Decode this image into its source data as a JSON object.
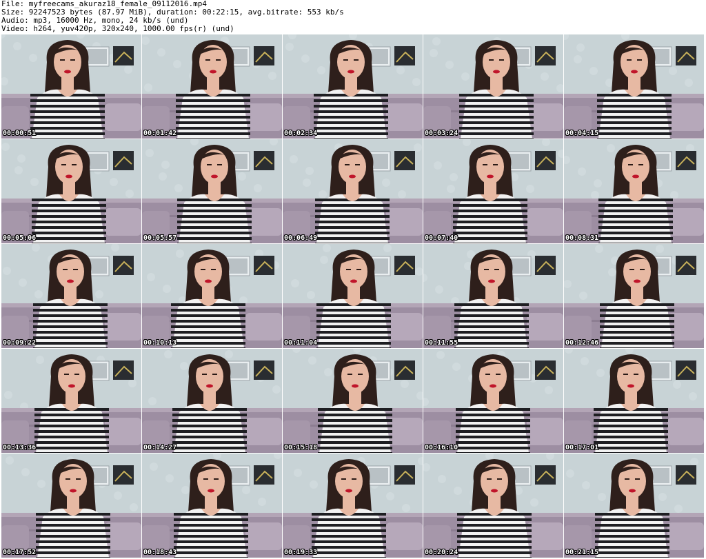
{
  "header": {
    "file_line": "File: myfreecams_akuraz18_female_09112016.mp4",
    "size_line": "Size: 92247523 bytes (87.97 MiB), duration: 00:22:15, avg.bitrate: 553 kb/s",
    "audio_line": "Audio: mp3, 16000 Hz, mono, 24 kb/s (und)",
    "video_line": "Video: h264, yuv420p, 320x240, 1000.00 fps(r) (und)"
  },
  "thumbnails": [
    {
      "time": "00:00:51"
    },
    {
      "time": "00:01:42"
    },
    {
      "time": "00:02:34"
    },
    {
      "time": "00:03:24"
    },
    {
      "time": "00:04:15"
    },
    {
      "time": "00:05:06"
    },
    {
      "time": "00:05:57"
    },
    {
      "time": "00:06:49"
    },
    {
      "time": "00:07:40"
    },
    {
      "time": "00:08:31"
    },
    {
      "time": "00:09:22"
    },
    {
      "time": "00:10:13"
    },
    {
      "time": "00:11:04"
    },
    {
      "time": "00:11:55"
    },
    {
      "time": "00:12:46"
    },
    {
      "time": "00:13:36"
    },
    {
      "time": "00:14:27"
    },
    {
      "time": "00:15:18"
    },
    {
      "time": "00:16:10"
    },
    {
      "time": "00:17:01"
    },
    {
      "time": "00:17:52"
    },
    {
      "time": "00:18:43"
    },
    {
      "time": "00:19:33"
    },
    {
      "time": "00:20:24"
    },
    {
      "time": "00:21:15"
    }
  ],
  "colors": {
    "wall": "#c8d3d6",
    "couch": "#9d8ea2",
    "hair": "#2e1f1b",
    "skin": "#e7b9a3",
    "stripe_dark": "#1e1e22",
    "stripe_light": "#f2f2f2",
    "lips": "#c0152a",
    "frame_dark": "#2a2d31"
  }
}
